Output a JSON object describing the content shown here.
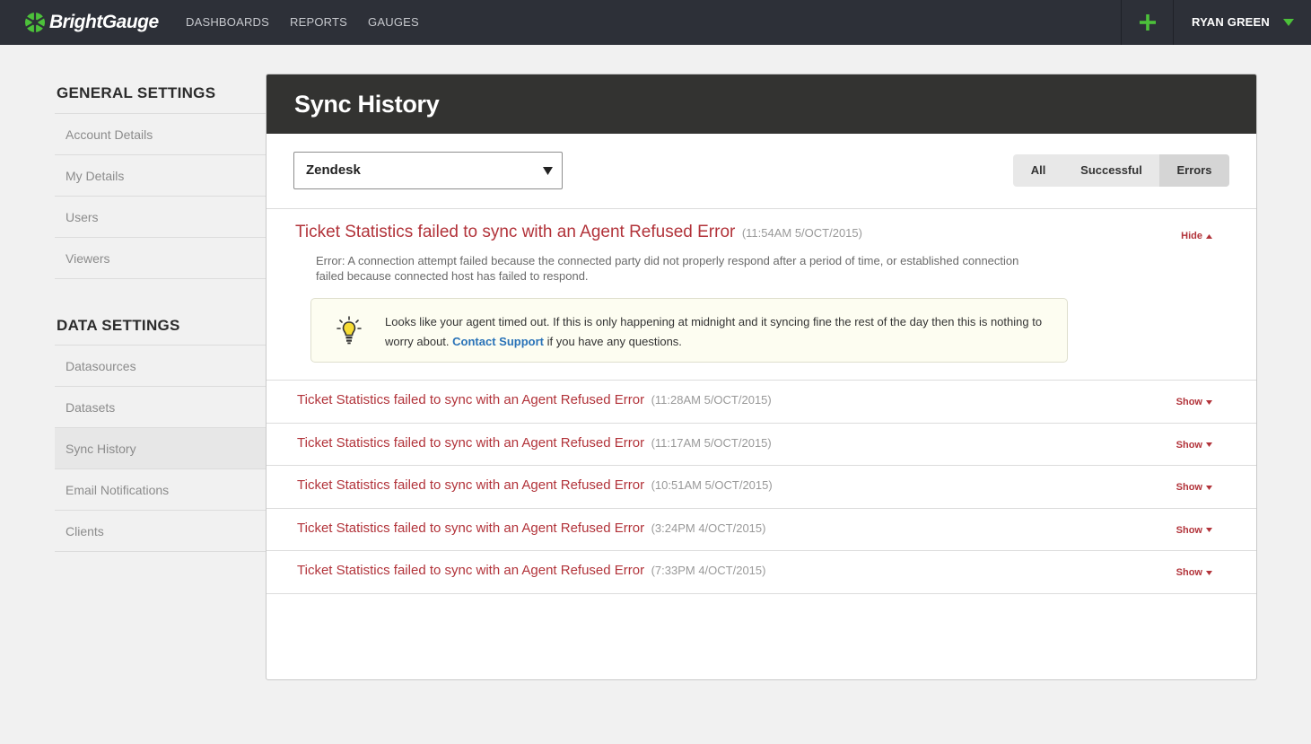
{
  "brand": {
    "name": "BrightGauge"
  },
  "nav": {
    "items": [
      "DASHBOARDS",
      "REPORTS",
      "GAUGES"
    ],
    "user": "RYAN GREEN",
    "add_icon": "plus-icon",
    "user_menu_icon": "chevron-down-icon",
    "accent": "#4cc13a"
  },
  "sidebar": {
    "general_heading": "GENERAL SETTINGS",
    "general_items": [
      "Account Details",
      "My Details",
      "Users",
      "Viewers"
    ],
    "data_heading": "DATA SETTINGS",
    "data_items": [
      "Datasources",
      "Datasets",
      "Sync History",
      "Email Notifications",
      "Clients"
    ],
    "active_item": "Sync History"
  },
  "panel": {
    "title": "Sync History",
    "datasource": {
      "selected": "Zendesk"
    },
    "filters": {
      "all": "All",
      "successful": "Successful",
      "errors": "Errors",
      "selected": "Errors"
    },
    "expanded": {
      "title": "Ticket Statistics failed to sync with an Agent Refused Error",
      "timestamp": "(11:54AM 5/OCT/2015)",
      "toggle": "Hide",
      "error": "Error: A connection attempt failed because the connected party did not properly respond after a period of time, or established connection failed because connected host has failed to respond.",
      "tip": {
        "icon": "lightbulb-icon",
        "text_before": "Looks like your agent timed out.  If this is only happening at midnight and it syncing fine the rest of the day then this is nothing to worry about. ",
        "link": "Contact Support",
        "text_after": " if you have any questions."
      }
    },
    "rows": [
      {
        "title": "Ticket Statistics failed to sync with an Agent Refused Error",
        "timestamp": "(11:28AM 5/OCT/2015)",
        "toggle": "Show"
      },
      {
        "title": "Ticket Statistics failed to sync with an Agent Refused Error",
        "timestamp": "(11:17AM 5/OCT/2015)",
        "toggle": "Show"
      },
      {
        "title": "Ticket Statistics failed to sync with an Agent Refused Error",
        "timestamp": "(10:51AM 5/OCT/2015)",
        "toggle": "Show"
      },
      {
        "title": "Ticket Statistics failed to sync with an Agent Refused Error",
        "timestamp": "(3:24PM 4/OCT/2015)",
        "toggle": "Show"
      },
      {
        "title": "Ticket Statistics failed to sync with an Agent Refused Error",
        "timestamp": "(7:33PM 4/OCT/2015)",
        "toggle": "Show"
      }
    ]
  }
}
